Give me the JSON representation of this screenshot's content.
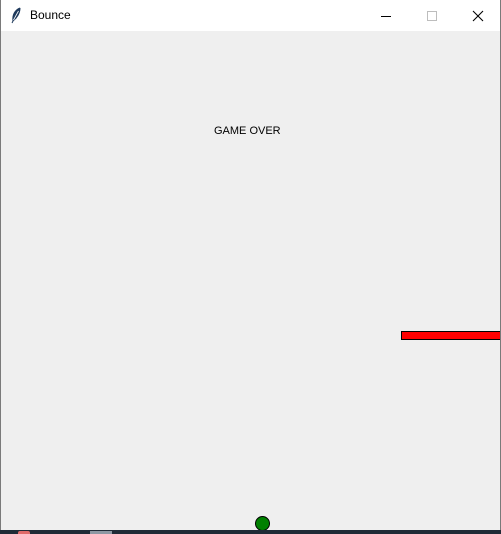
{
  "window": {
    "title": "Bounce",
    "app_icon": "feather-icon",
    "controls": {
      "minimize_icon": "minimize-icon",
      "maximize_icon": "maximize-icon",
      "close_icon": "close-icon"
    }
  },
  "game": {
    "status_text": "GAME OVER",
    "background_color": "#efefef",
    "paddle_color": "#ff0000",
    "ball_color": "#008000"
  }
}
